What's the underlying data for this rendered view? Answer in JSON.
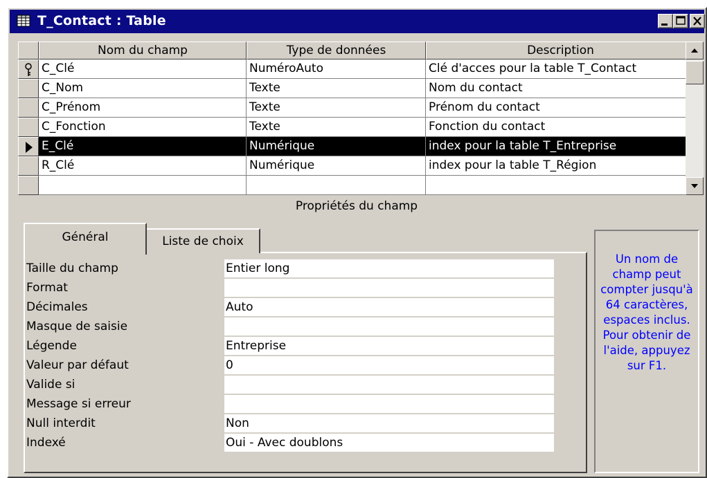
{
  "window": {
    "title": "T_Contact : Table"
  },
  "columns": {
    "field_name": "Nom du champ",
    "data_type": "Type de données",
    "description": "Description"
  },
  "rows": [
    {
      "name": "C_Clé",
      "type": "NuméroAuto",
      "description": "Clé d'acces pour la table T_Contact",
      "indicator": "key-icon"
    },
    {
      "name": "C_Nom",
      "type": "Texte",
      "description": "Nom du contact",
      "indicator": ""
    },
    {
      "name": "C_Prénom",
      "type": "Texte",
      "description": "Prénom du contact",
      "indicator": ""
    },
    {
      "name": "C_Fonction",
      "type": "Texte",
      "description": "Fonction du contact",
      "indicator": ""
    },
    {
      "name": "E_Clé",
      "type": "Numérique",
      "description": "index pour la table T_Entreprise",
      "indicator": "current-row-arrow-icon"
    },
    {
      "name": "R_Clé",
      "type": "Numérique",
      "description": "index pour la table T_Région",
      "indicator": ""
    },
    {
      "name": "",
      "type": "",
      "description": "",
      "indicator": ""
    }
  ],
  "properties_title": "Propriétés du champ",
  "tabs": [
    {
      "label": "Général",
      "active": true
    },
    {
      "label": "Liste de choix",
      "active": false
    }
  ],
  "properties": [
    {
      "label": "Taille du champ",
      "value": "Entier long"
    },
    {
      "label": "Format",
      "value": ""
    },
    {
      "label": "Décimales",
      "value": "Auto"
    },
    {
      "label": "Masque de saisie",
      "value": ""
    },
    {
      "label": "Légende",
      "value": "Entreprise"
    },
    {
      "label": "Valeur par défaut",
      "value": "0"
    },
    {
      "label": "Valide si",
      "value": ""
    },
    {
      "label": "Message si erreur",
      "value": ""
    },
    {
      "label": "Null interdit",
      "value": "Non"
    },
    {
      "label": "Indexé",
      "value": "Oui - Avec doublons"
    }
  ],
  "help": {
    "text": "Un nom de champ peut compter jusqu'à 64 caractères, espaces inclus. Pour obtenir de l'aide, appuyez sur F1."
  },
  "colors": {
    "titlebar": "#0a0a84",
    "face": "#d4d0c8",
    "selection": "#000000",
    "help_text": "#0000ff"
  }
}
